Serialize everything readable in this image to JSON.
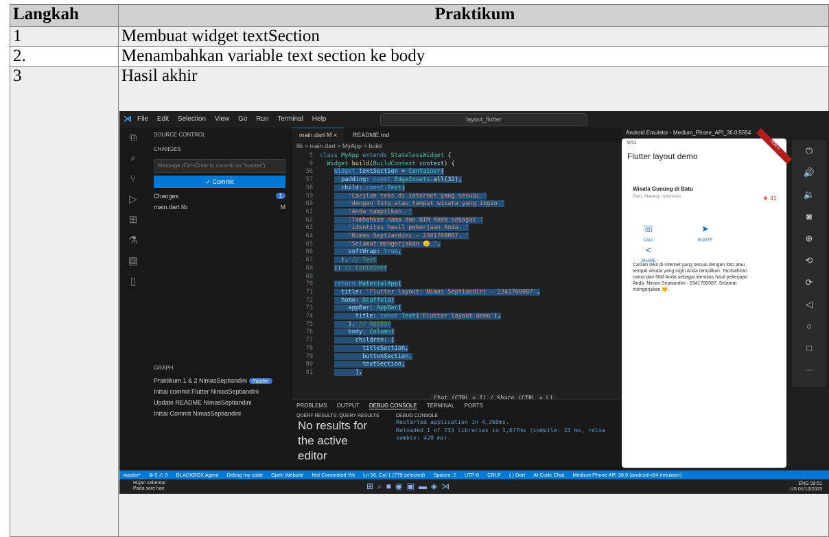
{
  "table": {
    "headers": [
      "Langkah",
      "Praktikum"
    ],
    "rows": [
      {
        "step": "1",
        "text": "Membuat widget textSection"
      },
      {
        "step": "2.",
        "text": "Menambahkan variable text section ke body"
      },
      {
        "step": "3",
        "text": "Hasil akhir"
      }
    ]
  },
  "vscode": {
    "menu": [
      "File",
      "Edit",
      "Selection",
      "View",
      "Go",
      "Run",
      "Terminal",
      "Help"
    ],
    "search": "layout_flutter",
    "source_control": "SOURCE CONTROL",
    "changes_header": "CHANGES",
    "message_placeholder": "Message (Ctrl+Enter to commit on \"master\")",
    "commit_label": "✓ Commit",
    "changes_label": "Changes",
    "changes_count": "1",
    "changed_file": "main.dart lib",
    "changed_flag": "M",
    "graph_header": "GRAPH",
    "graph_items": [
      "Praktikum 1 & 2 NimasSeptiandini",
      "Initial commit Flutter NimasSeptiandini",
      "Update README NimasSeptiandini",
      "Initial Commit NimasSeptiandini"
    ],
    "branch_badge": "master",
    "tab_active": "main.dart M ×",
    "tab_other": "README.md",
    "breadcrumb": "lib > main.dart > MyApp > build",
    "chat_hint": "Chat (CTRL + I) / Share (CTRL + L)",
    "panel_tabs": [
      "PROBLEMS",
      "OUTPUT",
      "DEBUG CONSOLE",
      "TERMINAL",
      "PORTS"
    ],
    "query_header": "QUERY RESULTS: QUERY RESULTS",
    "query_big": [
      "No results for",
      "the active",
      "editor"
    ],
    "debug_header": "DEBUG CONSOLE",
    "debug_lines": [
      "Restarted application in 4,360ms.",
      "Reloaded 1 of 733 libraries in 1,077ms (compile: 23 ms, reloa",
      "semble: 420 ms)."
    ],
    "status_items": [
      "master*",
      "⊗ 0 ⚠ 0",
      "BLACKBOX Agent",
      "Debug my code",
      "Open Website",
      "Not Committed Yet",
      "Ln 56, Col 1 (779 selected)",
      "Spaces: 2",
      "UTF-8",
      "CRLF",
      "{ } Dart",
      "AI Code Chat",
      "Medium Phone API 36.0 (android-x64 emulator)"
    ]
  },
  "emulator": {
    "title": "Android Emulator - Medium_Phone_API_36.0:5554",
    "time": "9:51",
    "appbar_title": "Flutter layout demo",
    "place_title": "Wisata Gunung di Batu",
    "place_sub": "Batu, Malang, Indonesia",
    "stars": "41",
    "buttons": [
      "CALL",
      "ROUTE",
      "SHARE"
    ],
    "description": "Carilah teks di internet yang sesuai dengan foto atau tempat wisata yang ingin Anda tampilkan. Tambahkan nama dan NIM Anda sebagai identitas hasil pekerjaan Anda. Nimas Septiandini - 2341760087. Selamat mengerjakan 🙂."
  },
  "taskbar": {
    "weather_title": "Hujan sebentar",
    "weather_sub": "Pada sore hari",
    "lang": "ENG",
    "region": "US",
    "time": "09:51",
    "date": "01/10/2025"
  }
}
